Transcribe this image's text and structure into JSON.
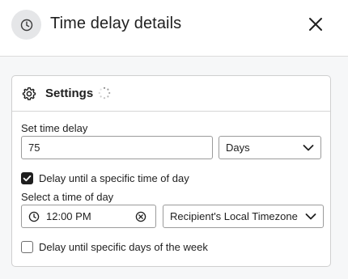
{
  "header": {
    "icon": "clock-icon",
    "title": "Time delay details",
    "close_icon": "close-icon"
  },
  "settings": {
    "gear_icon": "gear-icon",
    "title": "Settings",
    "spinner_icon": "loading-spinner-icon",
    "set_delay_label": "Set time delay",
    "delay_value": "75",
    "delay_unit": "Days",
    "delay_until_time": {
      "checked": true,
      "label": "Delay until a specific time of day"
    },
    "select_time_label": "Select a time of day",
    "time_value": "12:00 PM",
    "timezone": "Recipient's Local Timezone",
    "delay_until_days": {
      "checked": false,
      "label": "Delay until specific days of the week"
    }
  }
}
